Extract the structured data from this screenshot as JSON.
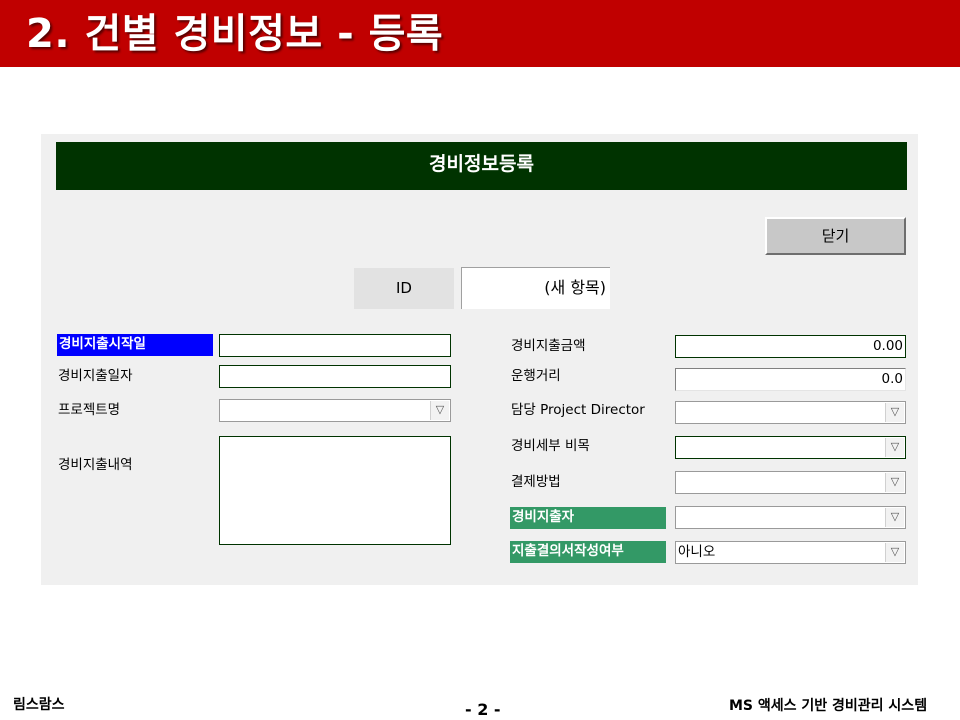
{
  "slide": {
    "title": "2. 건별 경비정보 - 등록"
  },
  "form": {
    "title": "경비정보등록",
    "close_button": "닫기",
    "id_label": "ID",
    "id_value": "(새 항목)",
    "left": {
      "start_label": "경비지출시작일",
      "start_value": "",
      "date_label": "경비지출일자",
      "date_value": "",
      "project_label": "프로젝트명",
      "project_value": "",
      "detail_label": "경비지출내역",
      "detail_value": ""
    },
    "right": {
      "amount_label": "경비지출금액",
      "amount_value": "0.00",
      "distance_label": "운행거리",
      "distance_value": "0.0",
      "director_label": "담당 Project Director",
      "director_value": "",
      "category_label": "경비세부 비목",
      "category_value": "",
      "payment_label": "결제방법",
      "payment_value": "",
      "spender_label": "경비지출자",
      "spender_value": "",
      "approval_label": "지출결의서작성여부",
      "approval_value": "아니오"
    },
    "icons": {
      "dropdown": "chevron-down-icon"
    },
    "colors": {
      "banner": "#003300",
      "required_blue": "#0000ff",
      "required_green": "#339966",
      "slide_header": "#c00000"
    }
  },
  "footer": {
    "left": "림스람스",
    "page": "- 2 -",
    "right": "MS 액세스 기반 경비관리 시스템"
  }
}
